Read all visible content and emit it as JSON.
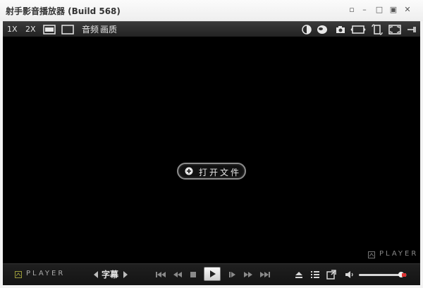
{
  "window": {
    "title": "射手影音播放器 (Build 568)",
    "controls": {
      "pin": "▫",
      "minimize": "–",
      "restore": "□",
      "maximize": "▣",
      "close": "✕"
    }
  },
  "toolbar": {
    "zoom_1x": "1X",
    "zoom_2x": "2X",
    "audio": "音频",
    "picture": "画质",
    "icons": [
      "stretch-icon",
      "fit-window-icon",
      "color-wheel-icon",
      "3d-icon",
      "camera-icon",
      "screen-rotate-icon",
      "rotate-icon",
      "fullscreen-icon",
      "pin-on-top-icon"
    ]
  },
  "video": {
    "open_file": "打开文件",
    "watermark": "PLAYER"
  },
  "controls": {
    "logo": "PLAYER",
    "subtitle": "字幕",
    "buttons": [
      "skip-back-icon",
      "rewind-icon",
      "stop-icon",
      "play-icon",
      "frame-step-icon",
      "fast-forward-icon",
      "skip-forward-icon",
      "eject-icon",
      "playlist-icon",
      "external-icon",
      "volume-icon"
    ],
    "volume_level": 0.88
  },
  "colors": {
    "accent": "#d33333",
    "video_bg": "#000000",
    "bar_bg": "#1a1a1a"
  }
}
